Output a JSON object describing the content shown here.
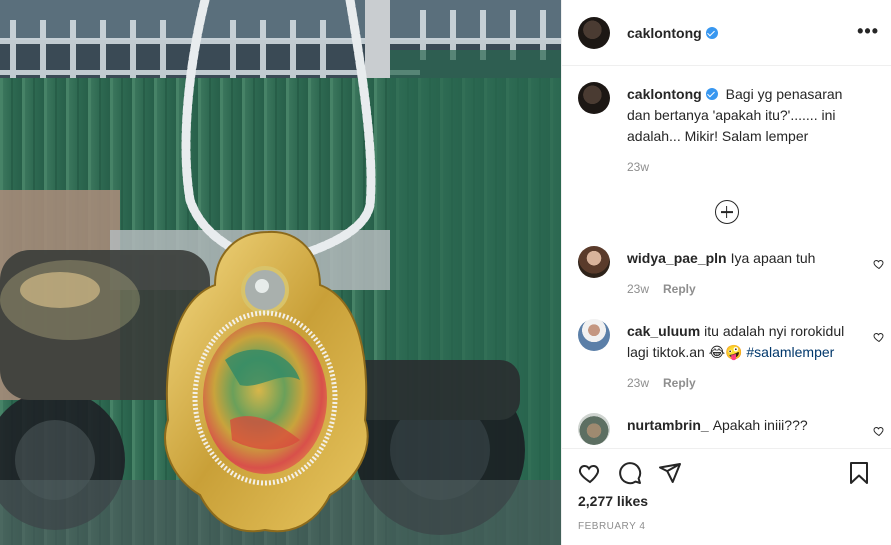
{
  "post": {
    "username": "caklontong",
    "verified": true,
    "more_icon": "more-horizontal-icon",
    "caption": {
      "username": "caklontong",
      "text": "Bagi yg penasaran dan bertanya 'apakah itu?'....... ini adalah... Mikir! Salam lemper",
      "time": "23w"
    },
    "load_more_icon": "plus-circle-icon",
    "comments": [
      {
        "username": "widya_pae_pln",
        "text": "Iya apaan tuh",
        "time": "23w",
        "reply_label": "Reply"
      },
      {
        "username": "cak_uluum",
        "text": "itu adalah nyi rorokidul lagi tiktok.an 😂🤪",
        "hashtag": "#salamlemper",
        "time": "23w",
        "reply_label": "Reply"
      },
      {
        "username": "nurtambrin_",
        "text": "Apakah iniii???"
      }
    ],
    "likes": "2,277 likes",
    "date": "February 4",
    "colors": {
      "verified": "#3897f0",
      "hashtag": "#00376b",
      "muted": "#8e8e8e"
    }
  }
}
